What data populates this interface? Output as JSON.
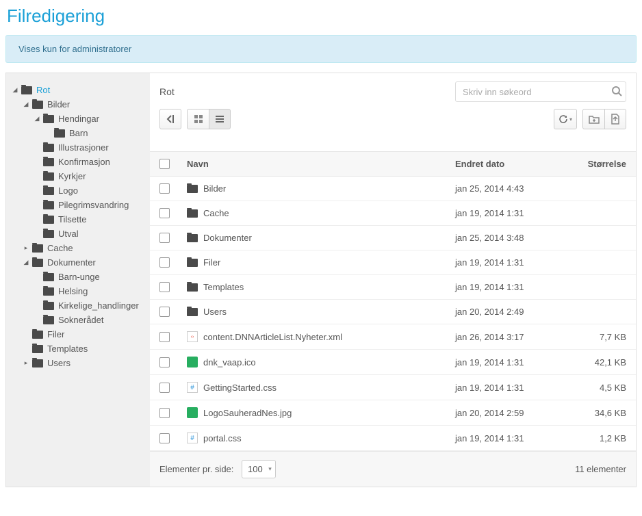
{
  "page_title": "Filredigering",
  "banner": "Vises kun for administratorer",
  "breadcrumb": "Rot",
  "search": {
    "placeholder": "Skriv inn søkeord"
  },
  "tree": [
    {
      "label": "Rot",
      "level": 0,
      "expanded": true,
      "active": true,
      "children": [
        {
          "label": "Bilder",
          "level": 1,
          "expanded": true,
          "children": [
            {
              "label": "Hendingar",
              "level": 2,
              "expanded": true,
              "children": [
                {
                  "label": "Barn",
                  "level": 3
                }
              ]
            },
            {
              "label": "Illustrasjoner",
              "level": 2
            },
            {
              "label": "Konfirmasjon",
              "level": 2
            },
            {
              "label": "Kyrkjer",
              "level": 2
            },
            {
              "label": "Logo",
              "level": 2
            },
            {
              "label": "Pilegrimsvandring",
              "level": 2
            },
            {
              "label": "Tilsette",
              "level": 2
            },
            {
              "label": "Utval",
              "level": 2
            }
          ]
        },
        {
          "label": "Cache",
          "level": 1,
          "collapsed": true
        },
        {
          "label": "Dokumenter",
          "level": 1,
          "expanded": true,
          "children": [
            {
              "label": "Barn-unge",
              "level": 2
            },
            {
              "label": "Helsing",
              "level": 2
            },
            {
              "label": "Kirkelige_handlinger",
              "level": 2
            },
            {
              "label": "Soknerådet",
              "level": 2
            }
          ]
        },
        {
          "label": "Filer",
          "level": 1
        },
        {
          "label": "Templates",
          "level": 1
        },
        {
          "label": "Users",
          "level": 1,
          "collapsed": true
        }
      ]
    }
  ],
  "columns": {
    "name": "Navn",
    "date": "Endret dato",
    "size": "Størrelse"
  },
  "rows": [
    {
      "type": "folder",
      "name": "Bilder",
      "date": "jan 25, 2014 4:43",
      "size": ""
    },
    {
      "type": "folder",
      "name": "Cache",
      "date": "jan 19, 2014 1:31",
      "size": ""
    },
    {
      "type": "folder",
      "name": "Dokumenter",
      "date": "jan 25, 2014 3:48",
      "size": ""
    },
    {
      "type": "folder",
      "name": "Filer",
      "date": "jan 19, 2014 1:31",
      "size": ""
    },
    {
      "type": "folder",
      "name": "Templates",
      "date": "jan 19, 2014 1:31",
      "size": ""
    },
    {
      "type": "folder",
      "name": "Users",
      "date": "jan 20, 2014 2:49",
      "size": ""
    },
    {
      "type": "xml",
      "name": "content.DNNArticleList.Nyheter.xml",
      "date": "jan 26, 2014 3:17",
      "size": "7,7 KB"
    },
    {
      "type": "ico",
      "name": "dnk_vaap.ico",
      "date": "jan 19, 2014 1:31",
      "size": "42,1 KB"
    },
    {
      "type": "css",
      "name": "GettingStarted.css",
      "date": "jan 19, 2014 1:31",
      "size": "4,5 KB"
    },
    {
      "type": "jpg",
      "name": "LogoSauheradNes.jpg",
      "date": "jan 20, 2014 2:59",
      "size": "34,6 KB"
    },
    {
      "type": "css",
      "name": "portal.css",
      "date": "jan 19, 2014 1:31",
      "size": "1,2 KB"
    }
  ],
  "footer": {
    "per_page_label": "Elementer pr. side:",
    "per_page_value": "100",
    "count": "11 elementer"
  }
}
